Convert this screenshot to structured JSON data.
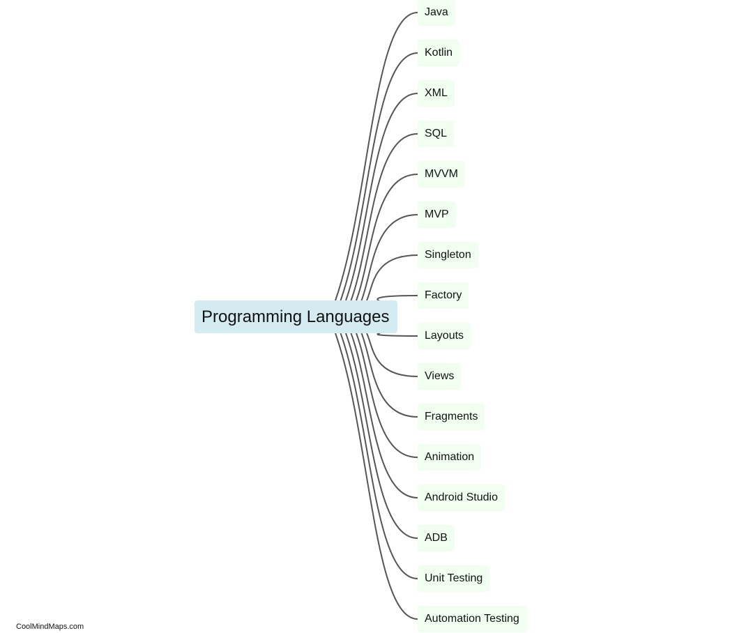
{
  "mindmap": {
    "root": {
      "label": "Programming Languages",
      "color": "#d4ebf1"
    },
    "children": [
      {
        "label": "Java"
      },
      {
        "label": "Kotlin"
      },
      {
        "label": "XML"
      },
      {
        "label": "SQL"
      },
      {
        "label": "MVVM"
      },
      {
        "label": "MVP"
      },
      {
        "label": "Singleton"
      },
      {
        "label": "Factory"
      },
      {
        "label": "Layouts"
      },
      {
        "label": "Views"
      },
      {
        "label": "Fragments"
      },
      {
        "label": "Animation"
      },
      {
        "label": "Android Studio"
      },
      {
        "label": "ADB"
      },
      {
        "label": "Unit Testing"
      },
      {
        "label": "Automation Testing"
      }
    ],
    "child_color": "#f0fff0",
    "edge_color": "#555555"
  },
  "watermark": "CoolMindMaps.com"
}
